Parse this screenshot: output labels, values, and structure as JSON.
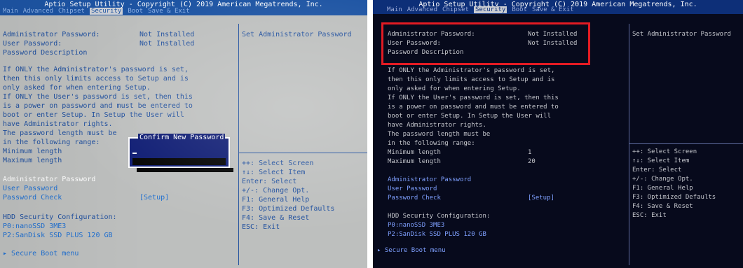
{
  "screenshots": [
    {
      "title": "Aptio Setup Utility - Copyright (C) 2019 American Megatrends, Inc.",
      "tabs": [
        "Main",
        "Advanced",
        "Chipset",
        "Security",
        "Boot",
        "Save & Exit"
      ],
      "active_tab": "Security",
      "pw_rows": [
        {
          "label": "Administrator Password:",
          "value": "Not Installed"
        },
        {
          "label": "User Password:",
          "value": "Not Installed"
        }
      ],
      "pw_desc": "Password Description",
      "description": [
        "If ONLY the Administrator's password is set,",
        "then this only limits access to Setup and is",
        "only asked for when entering Setup.",
        "If ONLY the User's password is set, then this",
        "is a power on password and must be entered to",
        "boot or enter Setup. In Setup the User will",
        "have Administrator rights.",
        "The password length must be",
        "in the following range:"
      ],
      "length_rows": [
        {
          "label": "Minimum length",
          "value": ""
        },
        {
          "label": "Maximum length",
          "value": ""
        }
      ],
      "menu": [
        {
          "label": "Administrator Password",
          "value": ""
        },
        {
          "label": "User Password",
          "value": ""
        },
        {
          "label": "Password Check",
          "value": "[Setup]"
        }
      ],
      "hdd_title": "HDD Security Configuration:",
      "hdd": [
        "P0:nanoSSD 3ME3",
        "P2:SanDisk SSD PLUS 120 GB"
      ],
      "secure_boot": "Secure Boot menu",
      "help": "Set Administrator Password",
      "keys": [
        "++: Select Screen",
        "↑↓: Select Item",
        "Enter: Select",
        "+/-: Change Opt.",
        "F1: General Help",
        "F3: Optimized Defaults",
        "F4: Save & Reset",
        "ESC: Exit"
      ],
      "dialog_title": "Confirm New Password"
    },
    {
      "title": "Aptio Setup Utility - Copyright (C) 2019 American Megatrends, Inc.",
      "tabs": [
        "Main",
        "Advanced",
        "Chipset",
        "Security",
        "Boot",
        "Save & Exit"
      ],
      "active_tab": "Security",
      "pw_rows": [
        {
          "label": "Administrator Password:",
          "value": "Not Installed"
        },
        {
          "label": "User Password:",
          "value": "Not Installed"
        }
      ],
      "pw_desc": "Password Description",
      "description": [
        "If ONLY the Administrator's password is set,",
        "then this only limits access to Setup and is",
        "only asked for when entering Setup.",
        "If ONLY the User's password is set, then this",
        "is a power on password and must be entered to",
        "boot or enter Setup. In Setup the User will",
        "have Administrator rights.",
        "The password length must be",
        "in the following range:"
      ],
      "length_rows": [
        {
          "label": "Minimum length",
          "value": "1"
        },
        {
          "label": "Maximum length",
          "value": "20"
        }
      ],
      "menu": [
        {
          "label": "Administrator Password",
          "value": ""
        },
        {
          "label": "User Password",
          "value": ""
        },
        {
          "label": "Password Check",
          "value": "[Setup]"
        }
      ],
      "hdd_title": "HDD Security Configuration:",
      "hdd": [
        "P0:nanoSSD 3ME3",
        "P2:SanDisk SSD PLUS 120 GB"
      ],
      "secure_boot": "Secure Boot menu",
      "help": "Set Administrator Password",
      "keys": [
        "++: Select Screen",
        "↑↓: Select Item",
        "Enter: Select",
        "+/-: Change Opt.",
        "F1: General Help",
        "F3: Optimized Defaults",
        "F4: Save & Reset",
        "ESC: Exit"
      ]
    }
  ]
}
